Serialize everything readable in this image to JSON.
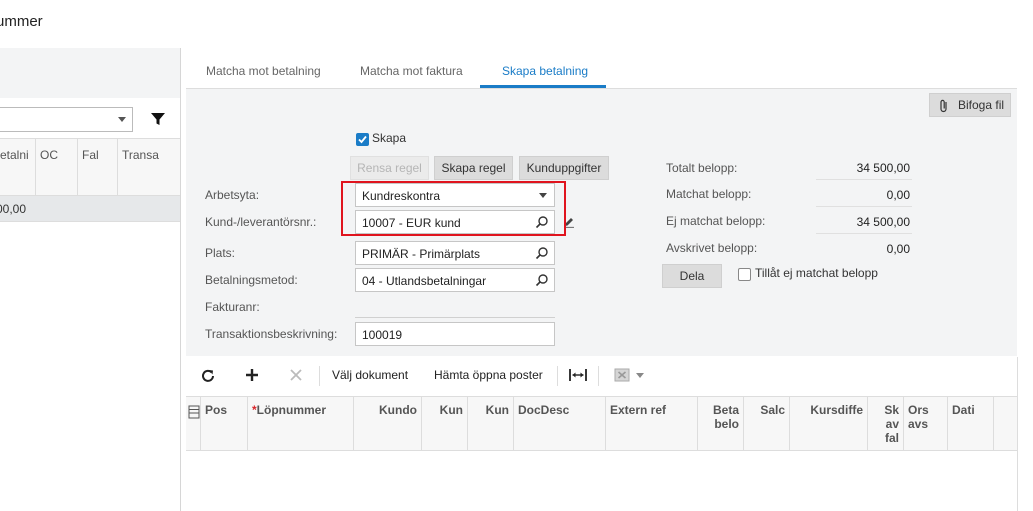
{
  "page": {
    "title": "ummer"
  },
  "left_panel": {
    "columns": [
      "etalni",
      "OC",
      "Fal",
      "Transa"
    ],
    "row_value": "00,00"
  },
  "tabs": [
    {
      "label": "Matcha mot betalning",
      "active": false
    },
    {
      "label": "Matcha mot faktura",
      "active": false
    },
    {
      "label": "Skapa betalning",
      "active": true
    }
  ],
  "form": {
    "attach_button": "Bifoga fil",
    "skapa_checkbox": {
      "label": "Skapa",
      "checked": true
    },
    "buttons": {
      "rensa_regel": "Rensa regel",
      "skapa_regel": "Skapa regel",
      "kunduppgifter": "Kunduppgifter",
      "dela": "Dela"
    },
    "fields": {
      "arbetsyta": {
        "label": "Arbetsyta:",
        "value": "Kundreskontra"
      },
      "kund": {
        "label": "Kund-/leverantörsnr.:",
        "value": "10007 - EUR kund"
      },
      "plats": {
        "label": "Plats:",
        "value": "PRIMÄR - Primärplats"
      },
      "betalningsmetod": {
        "label": "Betalningsmetod:",
        "value": "04 - Utlandsbetalningar"
      },
      "fakturanr": {
        "label": "Fakturanr:",
        "value": ""
      },
      "transaktionsbeskrivning": {
        "label": "Transaktionsbeskrivning:",
        "value": "100019"
      }
    },
    "totals": {
      "totalt": {
        "label": "Totalt belopp:",
        "value": "34 500,00"
      },
      "matchat": {
        "label": "Matchat belopp:",
        "value": "0,00"
      },
      "ej_matchat": {
        "label": "Ej matchat belopp:",
        "value": "34 500,00"
      },
      "avskrivet": {
        "label": "Avskrivet belopp:",
        "value": "0,00"
      }
    },
    "tillat_checkbox": {
      "label": "Tillåt ej matchat belopp",
      "checked": false
    }
  },
  "toolbar": {
    "valj_dokument": "Välj dokument",
    "hamta_oppna_poster": "Hämta öppna poster"
  },
  "grid": {
    "columns": [
      "Pos",
      "Löpnummer",
      "Kundo",
      "Kun",
      "Kun",
      "DocDesc",
      "Extern ref",
      "Beta belo",
      "Salc",
      "Kursdiffe",
      "Sk av fal",
      "Ors avs",
      "Dati"
    ],
    "required_marker": "*"
  },
  "colors": {
    "accent": "#1a7cc7",
    "highlight": "#e0141e"
  }
}
